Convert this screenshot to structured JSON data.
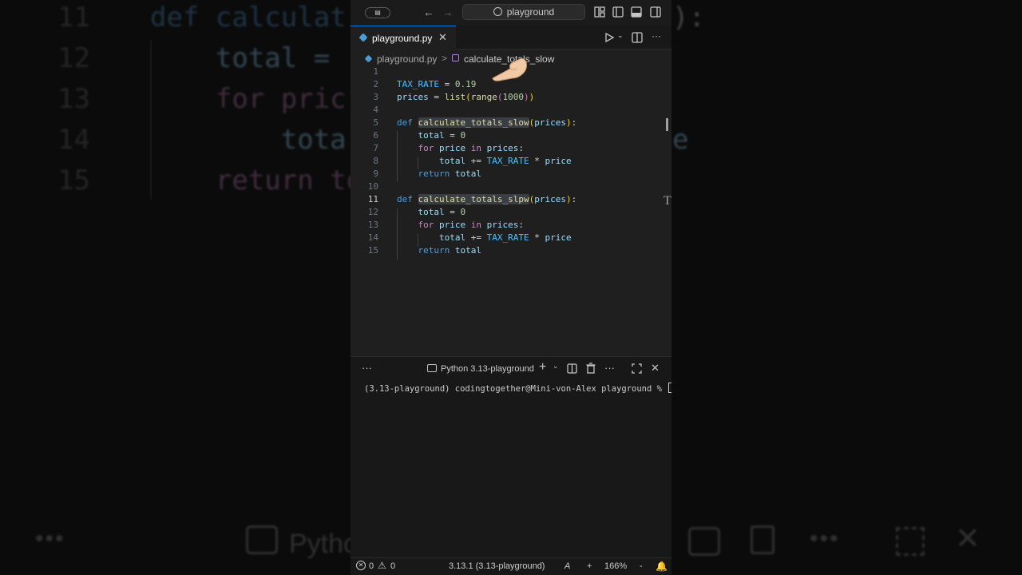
{
  "window": {
    "search_text": "playground"
  },
  "tab": {
    "label": "playground.py",
    "close": "✕"
  },
  "breadcrumb": {
    "file": "playground.py",
    "separator": ">",
    "symbol": "calculate_totals_slow"
  },
  "editor": {
    "lines": [
      {
        "n": "1",
        "code": ""
      },
      {
        "n": "2",
        "code": "TAX_RATE = 0.19"
      },
      {
        "n": "3",
        "code": "prices = list(range(1000))"
      },
      {
        "n": "4",
        "code": ""
      },
      {
        "n": "5",
        "code": "def calculate_totals_slow(prices):"
      },
      {
        "n": "6",
        "code": "    total = 0"
      },
      {
        "n": "7",
        "code": "    for price in prices:"
      },
      {
        "n": "8",
        "code": "        total += TAX_RATE * price"
      },
      {
        "n": "9",
        "code": "    return total"
      },
      {
        "n": "10",
        "code": ""
      },
      {
        "n": "11",
        "code": "def calculate_totals_slpw(prices):"
      },
      {
        "n": "12",
        "code": "    total = 0"
      },
      {
        "n": "13",
        "code": "    for price in prices:"
      },
      {
        "n": "14",
        "code": "        total += TAX_RATE * price"
      },
      {
        "n": "15",
        "code": "    return total"
      }
    ],
    "current_line": "11"
  },
  "panel": {
    "more": "···",
    "terminal_label": "Python 3.13-playground",
    "add": "+",
    "prompt": "(3.13-playground) codingtogether@Mini-von-Alex playground % "
  },
  "status": {
    "errors": "0",
    "warnings": "0",
    "interpreter": "3.13.1 (3.13-playground)",
    "zoom": "166%",
    "plus": "+",
    "minus": "-"
  },
  "background": {
    "lines": [
      {
        "n": "11",
        "text": "def calculat"
      },
      {
        "n": "12",
        "text": "    total = "
      },
      {
        "n": "13",
        "text": "    for pric"
      },
      {
        "n": "14",
        "text": "        tota"
      },
      {
        "n": "15",
        "text": "    return to"
      }
    ],
    "right_fragments": [
      "):",
      "",
      "",
      "e",
      ""
    ],
    "bottom_label": "Pytho"
  },
  "colors": {
    "accent": "#0078d4",
    "keyword": "#569cd6",
    "function": "#dcdcaa",
    "variable": "#9cdcfe",
    "constant": "#4fc1ff",
    "number": "#b5cea8"
  }
}
